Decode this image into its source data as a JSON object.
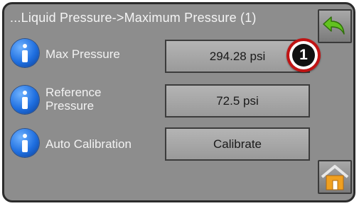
{
  "screen": {
    "title": "...Liquid Pressure->Maximum Pressure (1)"
  },
  "settings": [
    {
      "label": "Max Pressure",
      "value": "294.28 psi"
    },
    {
      "label": "Reference\nPressure",
      "value": "72.5 psi"
    },
    {
      "label": "Auto Calibration",
      "value": "Calibrate"
    }
  ],
  "callout": {
    "number": "1"
  },
  "icons": {
    "back": "back-arrow-icon",
    "home": "home-icon",
    "info": "info-icon"
  },
  "colors": {
    "background": "#8d8d8d",
    "info_blue": "#1f6fe0",
    "back_arrow_green": "#62c21f",
    "callout_red": "#c01414"
  }
}
